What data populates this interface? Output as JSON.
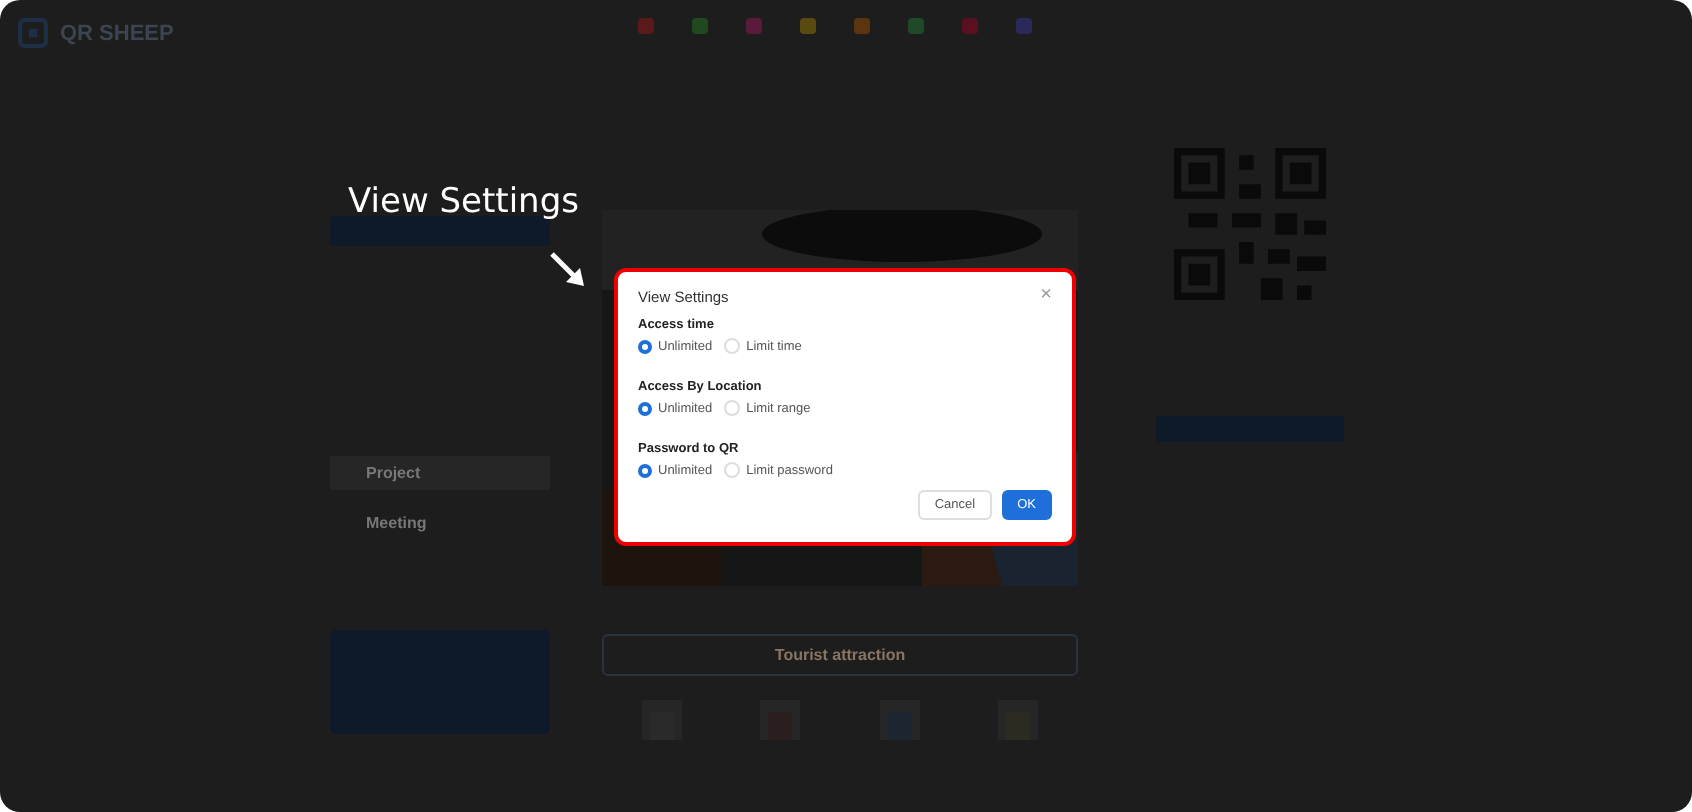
{
  "header": {
    "logo": "QR SHEEP"
  },
  "callout": {
    "text": "View Settings"
  },
  "left_panel": {
    "items": [
      {
        "label": "Project"
      },
      {
        "label": "Meeting"
      }
    ]
  },
  "center": {
    "category_button": "Tourist attraction"
  },
  "dialog": {
    "title": "View Settings",
    "close": "×",
    "sections": [
      {
        "label": "Access time",
        "options": [
          {
            "label": "Unlimited",
            "selected": true
          },
          {
            "label": "Limit time",
            "selected": false
          }
        ]
      },
      {
        "label": "Access By Location",
        "options": [
          {
            "label": "Unlimited",
            "selected": true
          },
          {
            "label": "Limit range",
            "selected": false
          }
        ]
      },
      {
        "label": "Password to QR",
        "options": [
          {
            "label": "Unlimited",
            "selected": true
          },
          {
            "label": "Limit password",
            "selected": false
          }
        ]
      }
    ],
    "buttons": [
      {
        "label": "Cancel",
        "kind": "secondary"
      },
      {
        "label": "OK",
        "kind": "primary"
      }
    ]
  }
}
